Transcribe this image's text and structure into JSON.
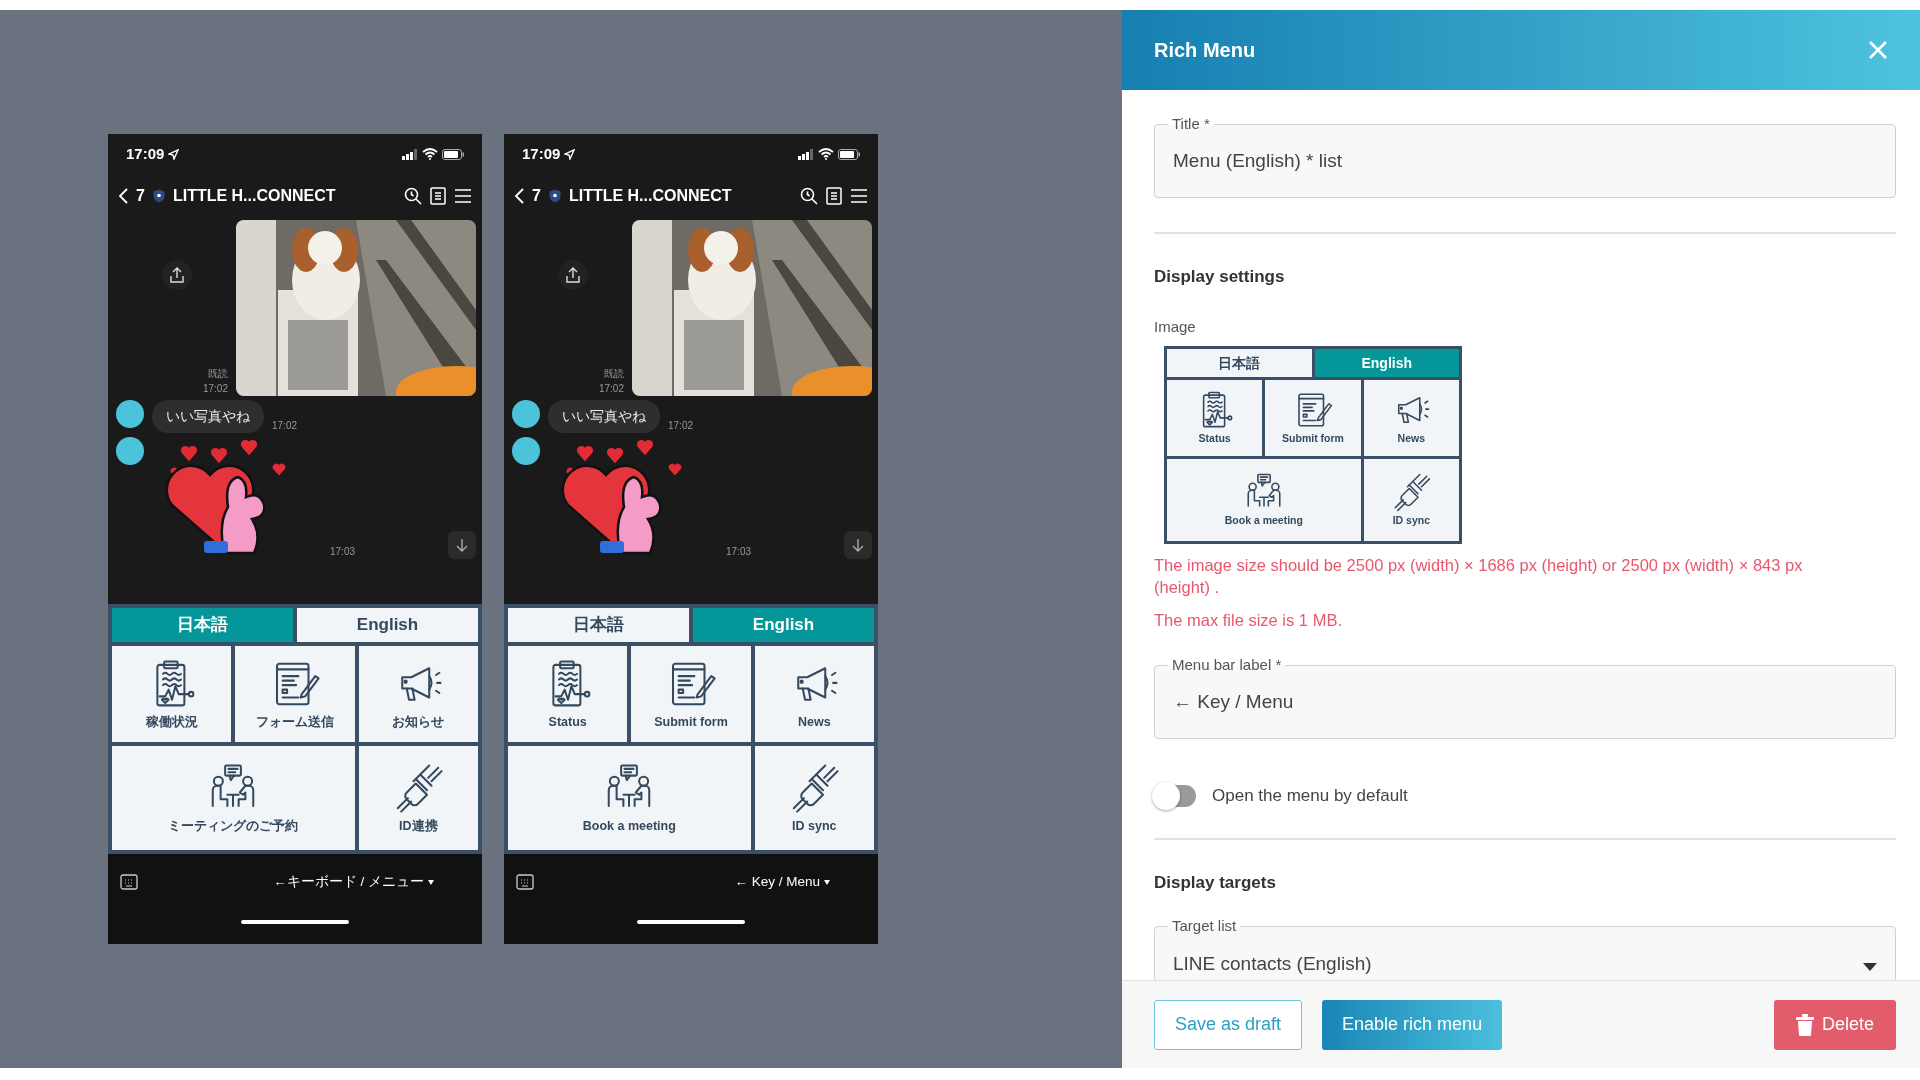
{
  "phones": [
    {
      "status_time": "17:09",
      "back_count": "7",
      "chat_title": "LITTLE H...CONNECT",
      "messages": [
        {
          "read_label": "既読",
          "time": "17:02"
        },
        {
          "kind": "text",
          "text": "いい写真やね",
          "time": "17:02"
        },
        {
          "kind": "sticker",
          "time": "17:03"
        }
      ],
      "rich_menu": {
        "tabs": [
          {
            "label": "日本語",
            "selected": true
          },
          {
            "label": "English",
            "selected": false
          }
        ],
        "items": [
          {
            "label": "稼働状況"
          },
          {
            "label": "フォーム送信"
          },
          {
            "label": "お知らせ"
          },
          {
            "label": "ミーティングのご予約"
          },
          {
            "label": "ID連携"
          }
        ]
      },
      "menu_bar_label": "←キーボード / メニュー"
    },
    {
      "status_time": "17:09",
      "back_count": "7",
      "chat_title": "LITTLE H...CONNECT",
      "messages": [
        {
          "read_label": "既読",
          "time": "17:02"
        },
        {
          "kind": "text",
          "text": "いい写真やね",
          "time": "17:02"
        },
        {
          "kind": "sticker",
          "time": "17:03"
        }
      ],
      "rich_menu": {
        "tabs": [
          {
            "label": "日本語",
            "selected": false
          },
          {
            "label": "English",
            "selected": true
          }
        ],
        "items": [
          {
            "label": "Status"
          },
          {
            "label": "Submit form"
          },
          {
            "label": "News"
          },
          {
            "label": "Book a meeting"
          },
          {
            "label": "ID sync"
          }
        ]
      },
      "menu_bar_label": "← Key / Menu"
    }
  ],
  "panel": {
    "title": "Rich Menu",
    "title_field": {
      "label": "Title *",
      "value": "Menu (English) * list"
    },
    "display_settings": {
      "heading": "Display settings",
      "image_label": "Image",
      "image": {
        "tabs": [
          {
            "label": "日本語",
            "selected": false
          },
          {
            "label": "English",
            "selected": true
          }
        ],
        "items": [
          {
            "label": "Status"
          },
          {
            "label": "Submit form"
          },
          {
            "label": "News"
          },
          {
            "label": "Book a meeting"
          },
          {
            "label": "ID sync"
          }
        ]
      },
      "notes": [
        "The image size should be 2500 px (width) × 1686 px (height) or 2500 px (width) × 843 px (height) .",
        "The max file size is 1 MB."
      ],
      "menu_bar_field": {
        "label": "Menu bar label *",
        "value": "← Key / Menu"
      },
      "default_open": {
        "label": "Open the menu by default",
        "on": false
      }
    },
    "display_targets": {
      "heading": "Display targets",
      "target_field": {
        "label": "Target list",
        "value": "LINE contacts (English)"
      }
    },
    "buttons": [
      {
        "label": "Save as draft",
        "kind": "outline"
      },
      {
        "label": "Enable rich menu",
        "kind": "primary"
      },
      {
        "label": "Delete",
        "kind": "danger"
      }
    ]
  }
}
